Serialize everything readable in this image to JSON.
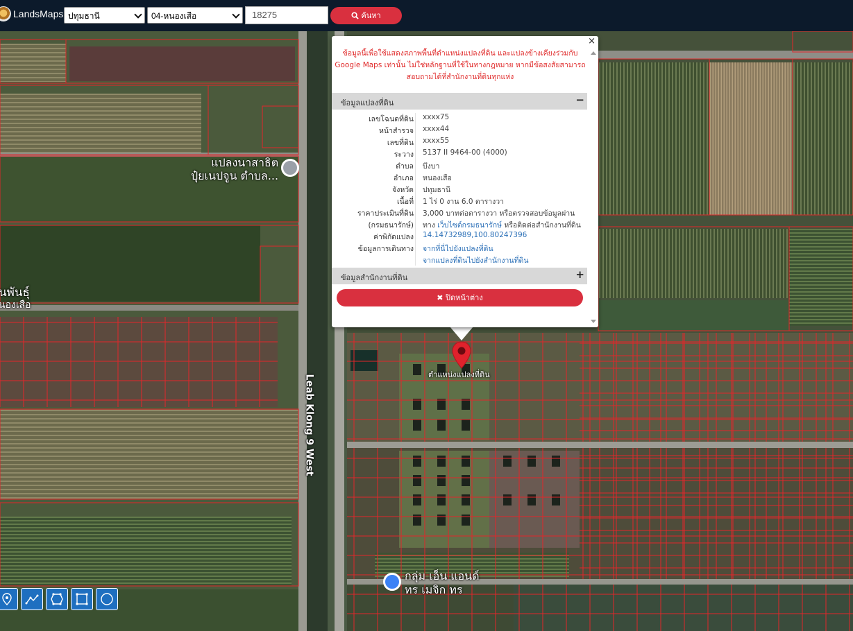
{
  "app": {
    "brand": "LandsMaps"
  },
  "search": {
    "province": "ปทุมธานี",
    "district": "04-หนองเสือ",
    "parcel_number": "18275",
    "button_label": "ค้นหา"
  },
  "map_labels": {
    "poi_1_line1": "แปลงนาสาธิต",
    "poi_1_line2": "ปุ๋ยเนปจูน ตำบล...",
    "left_label_line1": "นพันธุ์",
    "left_label_line2": "นองเสือ",
    "road": "Leab Klong 9 West",
    "pin_label": "ตำแหน่งแปลงที่ดิน",
    "poi_2_line1": "กลุ่ม เอ็น แอนด์",
    "poi_2_line2": "ทร เมจิก ทร"
  },
  "popup": {
    "close_symbol": "×",
    "notice": "ข้อมูลนี้เพื่อใช้แสดงสภาพพื้นที่ตำแหน่งแปลงที่ดิน และแปลงข้างเคียงร่วมกับ Google Maps เท่านั้น ไม่ใช่หลักฐานที่ใช้ในทางกฎหมาย หากมีข้อสงสัยสามารถสอบถามได้ที่สำนักงานที่ดินทุกแห่ง",
    "section_parcel": "ข้อมูลแปลงที่ดิน",
    "section_parcel_sign": "−",
    "section_office": "ข้อมูลสำนักงานที่ดิน",
    "section_office_sign": "+",
    "rows": {
      "deed_label": "เลขโฉนดที่ดิน",
      "deed_value": "xxxx75",
      "survey_label": "หน้าสำรวจ",
      "survey_value": "xxxx44",
      "land_label": "เลขที่ดิน",
      "land_value": "xxxx55",
      "sheet_label": "ระวาง",
      "sheet_value": "5137 II 9464-00 (4000)",
      "subdistrict_label": "ตำบล",
      "subdistrict_value": "บึงบา",
      "district_label": "อำเภอ",
      "district_value": "หนองเสือ",
      "province_label": "จังหวัด",
      "province_value": "ปทุมธานี",
      "area_label": "เนื้อที่",
      "area_value": "1 ไร่ 0 งาน 6.0 ตารางวา",
      "price_label": "ราคาประเมินที่ดิน",
      "price_value": "3,000 บาทต่อตารางวา หรือตรวจสอบข้อมูลผ่าน",
      "treasury_label": "(กรมธนารักษ์)",
      "treasury_prefix": "ทาง",
      "treasury_link": "เว็บไซต์กรมธนารักษ์",
      "treasury_suffix": "หรือติดต่อสำนักงานที่ดิน",
      "coord_label": "ค่าพิกัดแปลง",
      "coord_value": "14.14732989,100.80247396",
      "travel_label": "ข้อมูลการเดินทาง",
      "travel_link_1": "จากที่นี่ไปยังแปลงที่ดิน",
      "travel_link_2": "จากแปลงที่ดินไปยังสำนักงานที่ดิน"
    },
    "close_button": "ปิดหน้าต่าง",
    "close_button_icon": "✖"
  },
  "icons": {
    "search": "search-icon",
    "marker": "map-marker-icon",
    "tools": [
      "marker-tool-icon",
      "polyline-tool-icon",
      "polygon-tool-icon",
      "rectangle-tool-icon",
      "circle-tool-icon"
    ]
  },
  "colors": {
    "topbar": "#0c1a2b",
    "accent_red": "#d9303f",
    "notice_red": "#e02a2a",
    "link_blue": "#2a6fb7",
    "parcel_line": "#e3262a",
    "tool_blue": "#1e6fc0"
  }
}
